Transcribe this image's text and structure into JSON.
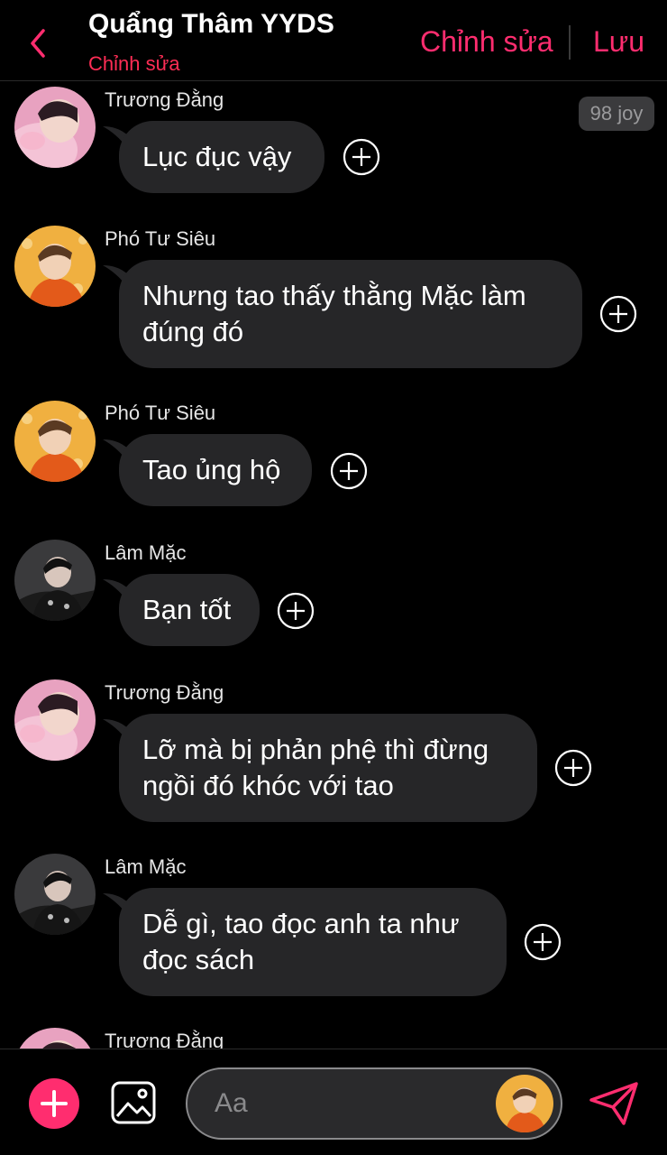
{
  "header": {
    "title": "Quẩng Thâm YYDS",
    "subtitle": "Chỉnh sửa",
    "edit_label": "Chỉnh sửa",
    "save_label": "Lưu",
    "accent_color": "#ff2d6f"
  },
  "badge": {
    "text": "98 joy"
  },
  "messages": [
    {
      "sender": "Trương Đằng",
      "text": "Lục đục vậy",
      "avatar": "truong-dang"
    },
    {
      "sender": "Phó Tư Siêu",
      "text": "Nhưng tao thấy thằng Mặc làm đúng đó",
      "avatar": "pho-tu-sieu"
    },
    {
      "sender": "Phó Tư Siêu",
      "text": "Tao ủng hộ",
      "avatar": "pho-tu-sieu"
    },
    {
      "sender": "Lâm Mặc",
      "text": "Bạn tốt",
      "avatar": "lam-mac"
    },
    {
      "sender": "Trương Đằng",
      "text": "Lỡ mà bị phản phệ thì đừng ngồi đó khóc với tao",
      "avatar": "truong-dang"
    },
    {
      "sender": "Lâm Mặc",
      "text": "Dễ gì, tao đọc anh ta như đọc sách",
      "avatar": "lam-mac"
    },
    {
      "sender": "Trương Đằng",
      "text": "",
      "avatar": "truong-dang"
    }
  ],
  "composer": {
    "placeholder": "Aa"
  },
  "icons": {
    "back": "chevron-left-icon",
    "add": "plus-icon",
    "image": "image-icon",
    "send": "send-icon",
    "react": "plus-circle-icon"
  }
}
